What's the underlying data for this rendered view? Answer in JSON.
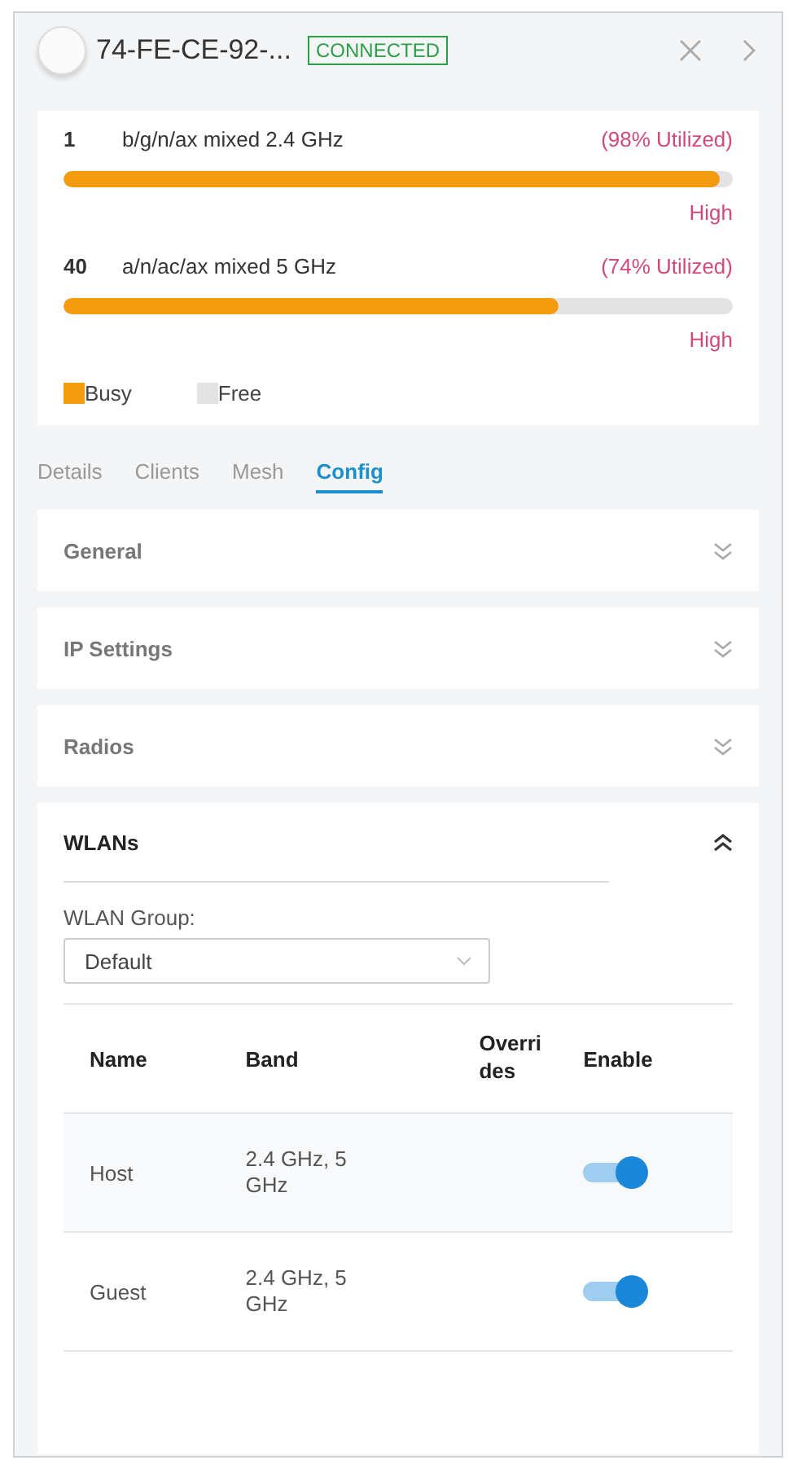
{
  "header": {
    "device_name": "74-FE-CE-92-...",
    "status": "CONNECTED"
  },
  "radios": [
    {
      "channel": "1",
      "mode": "b/g/n/ax mixed  2.4 GHz",
      "utilization": "(98% Utilized)",
      "level": 0.98,
      "rating": "High"
    },
    {
      "channel": "40",
      "mode": "a/n/ac/ax mixed  5 GHz",
      "utilization": "(74% Utilized)",
      "level": 0.74,
      "rating": "High"
    }
  ],
  "legend": [
    {
      "label": "Busy",
      "color": "#f39a0f"
    },
    {
      "label": "Free",
      "color": "#e3e3e3"
    }
  ],
  "tabs": [
    {
      "label": "Details",
      "selected": false
    },
    {
      "label": "Clients",
      "selected": false
    },
    {
      "label": "Mesh",
      "selected": false
    },
    {
      "label": "Config",
      "selected": true
    }
  ],
  "sections": [
    {
      "title": "General",
      "expanded": false
    },
    {
      "title": "IP Settings",
      "expanded": false
    },
    {
      "title": "Radios",
      "expanded": false
    },
    {
      "title": "WLANs",
      "expanded": true
    }
  ],
  "wlan_group": {
    "label": "WLAN Group:",
    "value": "Default"
  },
  "table": {
    "columns": [
      "Name",
      "Band",
      "Overrides",
      "Enable"
    ],
    "rows": [
      {
        "name": "Host",
        "band": "2.4 GHz, 5 GHz",
        "enabled": true
      },
      {
        "name": "Guest",
        "band": "2.4 GHz, 5 GHz",
        "enabled": true
      }
    ]
  }
}
